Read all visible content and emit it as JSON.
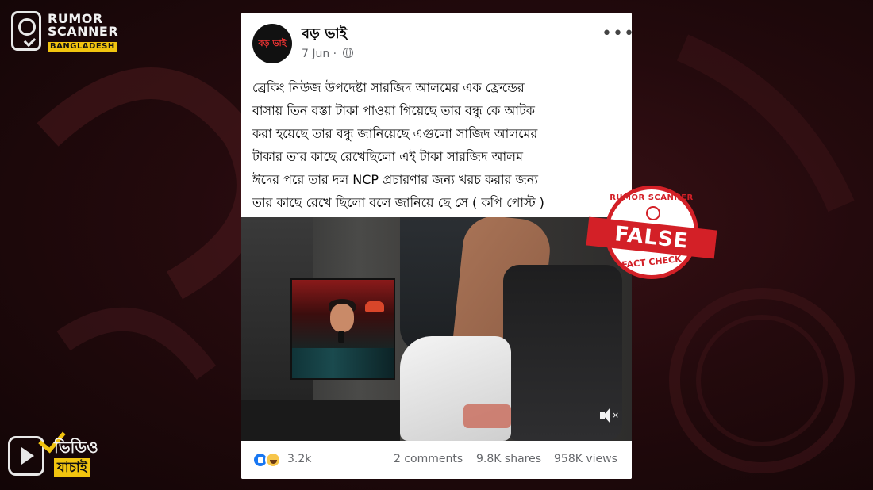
{
  "brand": {
    "logo_line1": "RUMOR",
    "logo_line2": "SCANNER",
    "logo_sub": "BANGLADESH"
  },
  "video_logo": {
    "line1": "ভিডিও",
    "line2": "যাচাই"
  },
  "post": {
    "page_name": "বড় ভাই",
    "avatar_text": "বড় ভাই",
    "date": "7 Jun ·",
    "text_lines": [
      "ব্রেকিং নিউজ উপদেষ্টা সারজিদ আলমের এক ফ্রেন্ডের",
      "বাসায় তিন বস্তা টাকা পাওয়া গিয়েছে তার বন্ধু কে আটক",
      "করা হয়েছে তার বন্ধু জানিয়েছে এগুলো সাজিদ আলমের",
      "টাকার তার কাছে রেখেছিলো এই টাকা সারজিদ আলম",
      "ঈদের  পরে তার দল NCP প্রচারণার জন্য খরচ করার জন্য",
      "তার কাছে রেখে ছিলো বলে জানিয়ে ছে সে  ( কপি পোস্ট )"
    ],
    "reactions_count": "3.2k",
    "comments": "2 comments",
    "shares": "9.8K shares",
    "views": "958K views"
  },
  "stamp": {
    "top_text": "RUMOR SCANNER",
    "main": "FALSE",
    "bottom_text": "FACT CHECK"
  },
  "colors": {
    "stamp_red": "#d32027",
    "accent_yellow": "#f1c40f",
    "facebook_blue": "#1877f2"
  }
}
